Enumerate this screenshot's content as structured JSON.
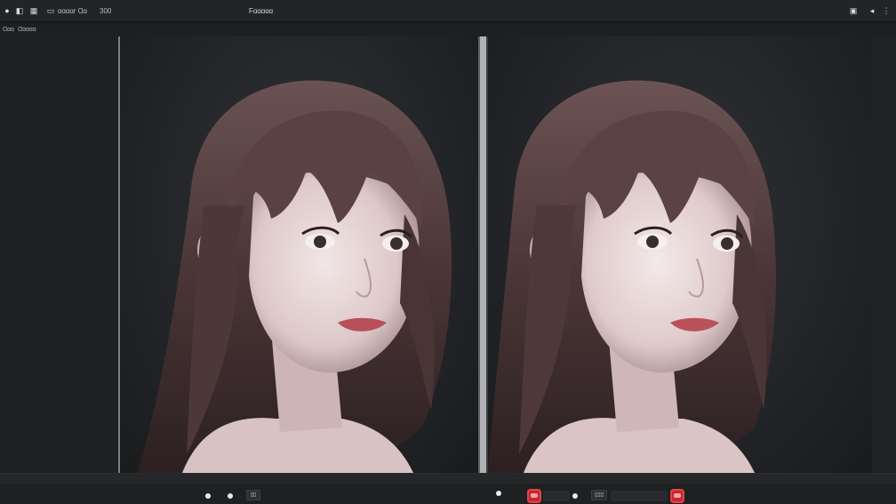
{
  "titlebar": {
    "left_text": "ɑɑɑɑr Ɑɑ",
    "num_text": "300",
    "title": "Fɑɑɑɑɑ"
  },
  "menubar": {
    "items": [
      "Ɑɑɑ",
      "Ɑɑɑɑɑ"
    ]
  },
  "bottombar": {
    "left_box": "▯▯",
    "right_box": "▯▯▯"
  },
  "icons": {
    "app": "app-icon",
    "file": "file-icon",
    "grid": "grid-icon",
    "frame": "frame-icon",
    "save": "save-icon",
    "share": "share-icon",
    "more": "more-icon"
  },
  "colors": {
    "accent_red": "#c6262e",
    "background": "#1c1d1f",
    "split_handle": "#aeb0b3"
  }
}
